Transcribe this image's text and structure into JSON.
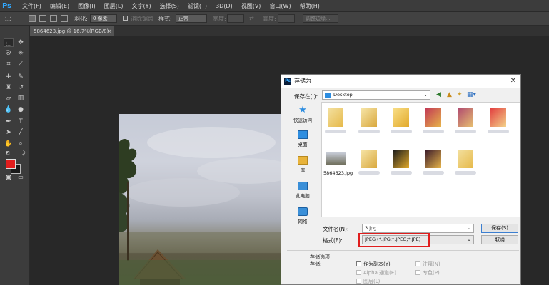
{
  "app": {
    "logo": "Ps",
    "menu": [
      "文件(F)",
      "编辑(E)",
      "图像(I)",
      "图层(L)",
      "文字(Y)",
      "选择(S)",
      "滤镜(T)",
      "3D(D)",
      "视图(V)",
      "窗口(W)",
      "帮助(H)"
    ]
  },
  "options_bar": {
    "feather_label": "羽化:",
    "feather_value": "0 像素",
    "antialias_label": "消除锯齿",
    "style_label": "样式:",
    "style_value": "正常",
    "width_label": "宽度:",
    "height_label": "高度:",
    "refine_edge_label": "调整边缘..."
  },
  "document": {
    "tab_title": "5864623.jpg @ 16.7%(RGB/8)",
    "tab_close": "×"
  },
  "dialog": {
    "title": "存储为",
    "close": "✕",
    "save_in_label": "保存在(I):",
    "save_in_value": "Desktop",
    "places": [
      "快速访问",
      "桌面",
      "库",
      "此电脑",
      "网络"
    ],
    "file_caption": "5864623.jpg",
    "filename_label": "文件名(N):",
    "filename_value": "3.jpg",
    "format_label": "格式(F):",
    "format_value": "JPEG (*.JPG;*.JPEG;*.JPE)",
    "save_button": "保存(S)",
    "cancel_button": "取消",
    "options_header": "存储选项",
    "options_save_label": "存储:",
    "options": {
      "as_copy": "作为副本(Y)",
      "alpha": "Alpha 通道(E)",
      "layers": "图层(L)",
      "notes": "注释(N)",
      "spot": "专色(P)"
    }
  },
  "colors": {
    "ps_blue": "#31a8ff",
    "foreground": "#e01d1d",
    "highlight_box": "#e01d1d"
  }
}
